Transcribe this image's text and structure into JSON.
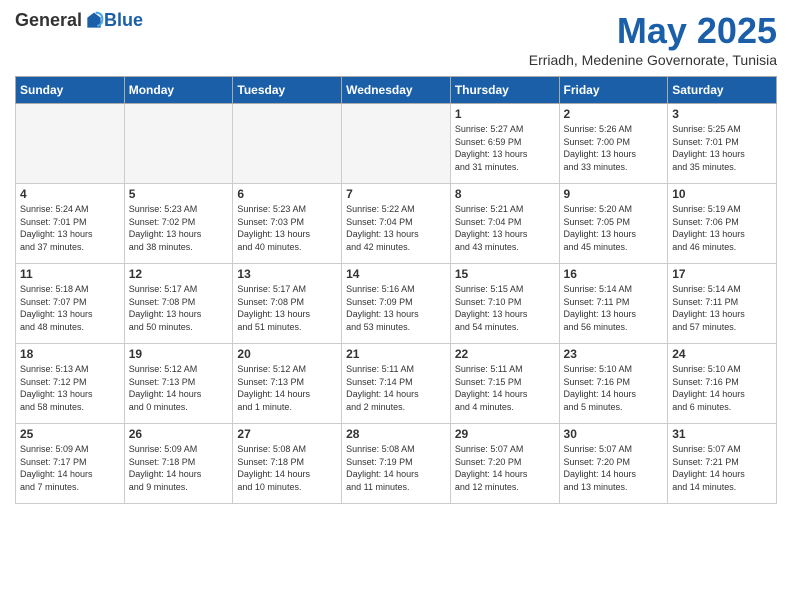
{
  "logo": {
    "general": "General",
    "blue": "Blue"
  },
  "header": {
    "month": "May 2025",
    "location": "Erriadh, Medenine Governorate, Tunisia"
  },
  "weekdays": [
    "Sunday",
    "Monday",
    "Tuesday",
    "Wednesday",
    "Thursday",
    "Friday",
    "Saturday"
  ],
  "weeks": [
    [
      {
        "day": "",
        "info": ""
      },
      {
        "day": "",
        "info": ""
      },
      {
        "day": "",
        "info": ""
      },
      {
        "day": "",
        "info": ""
      },
      {
        "day": "1",
        "info": "Sunrise: 5:27 AM\nSunset: 6:59 PM\nDaylight: 13 hours\nand 31 minutes."
      },
      {
        "day": "2",
        "info": "Sunrise: 5:26 AM\nSunset: 7:00 PM\nDaylight: 13 hours\nand 33 minutes."
      },
      {
        "day": "3",
        "info": "Sunrise: 5:25 AM\nSunset: 7:01 PM\nDaylight: 13 hours\nand 35 minutes."
      }
    ],
    [
      {
        "day": "4",
        "info": "Sunrise: 5:24 AM\nSunset: 7:01 PM\nDaylight: 13 hours\nand 37 minutes."
      },
      {
        "day": "5",
        "info": "Sunrise: 5:23 AM\nSunset: 7:02 PM\nDaylight: 13 hours\nand 38 minutes."
      },
      {
        "day": "6",
        "info": "Sunrise: 5:23 AM\nSunset: 7:03 PM\nDaylight: 13 hours\nand 40 minutes."
      },
      {
        "day": "7",
        "info": "Sunrise: 5:22 AM\nSunset: 7:04 PM\nDaylight: 13 hours\nand 42 minutes."
      },
      {
        "day": "8",
        "info": "Sunrise: 5:21 AM\nSunset: 7:04 PM\nDaylight: 13 hours\nand 43 minutes."
      },
      {
        "day": "9",
        "info": "Sunrise: 5:20 AM\nSunset: 7:05 PM\nDaylight: 13 hours\nand 45 minutes."
      },
      {
        "day": "10",
        "info": "Sunrise: 5:19 AM\nSunset: 7:06 PM\nDaylight: 13 hours\nand 46 minutes."
      }
    ],
    [
      {
        "day": "11",
        "info": "Sunrise: 5:18 AM\nSunset: 7:07 PM\nDaylight: 13 hours\nand 48 minutes."
      },
      {
        "day": "12",
        "info": "Sunrise: 5:17 AM\nSunset: 7:08 PM\nDaylight: 13 hours\nand 50 minutes."
      },
      {
        "day": "13",
        "info": "Sunrise: 5:17 AM\nSunset: 7:08 PM\nDaylight: 13 hours\nand 51 minutes."
      },
      {
        "day": "14",
        "info": "Sunrise: 5:16 AM\nSunset: 7:09 PM\nDaylight: 13 hours\nand 53 minutes."
      },
      {
        "day": "15",
        "info": "Sunrise: 5:15 AM\nSunset: 7:10 PM\nDaylight: 13 hours\nand 54 minutes."
      },
      {
        "day": "16",
        "info": "Sunrise: 5:14 AM\nSunset: 7:11 PM\nDaylight: 13 hours\nand 56 minutes."
      },
      {
        "day": "17",
        "info": "Sunrise: 5:14 AM\nSunset: 7:11 PM\nDaylight: 13 hours\nand 57 minutes."
      }
    ],
    [
      {
        "day": "18",
        "info": "Sunrise: 5:13 AM\nSunset: 7:12 PM\nDaylight: 13 hours\nand 58 minutes."
      },
      {
        "day": "19",
        "info": "Sunrise: 5:12 AM\nSunset: 7:13 PM\nDaylight: 14 hours\nand 0 minutes."
      },
      {
        "day": "20",
        "info": "Sunrise: 5:12 AM\nSunset: 7:13 PM\nDaylight: 14 hours\nand 1 minute."
      },
      {
        "day": "21",
        "info": "Sunrise: 5:11 AM\nSunset: 7:14 PM\nDaylight: 14 hours\nand 2 minutes."
      },
      {
        "day": "22",
        "info": "Sunrise: 5:11 AM\nSunset: 7:15 PM\nDaylight: 14 hours\nand 4 minutes."
      },
      {
        "day": "23",
        "info": "Sunrise: 5:10 AM\nSunset: 7:16 PM\nDaylight: 14 hours\nand 5 minutes."
      },
      {
        "day": "24",
        "info": "Sunrise: 5:10 AM\nSunset: 7:16 PM\nDaylight: 14 hours\nand 6 minutes."
      }
    ],
    [
      {
        "day": "25",
        "info": "Sunrise: 5:09 AM\nSunset: 7:17 PM\nDaylight: 14 hours\nand 7 minutes."
      },
      {
        "day": "26",
        "info": "Sunrise: 5:09 AM\nSunset: 7:18 PM\nDaylight: 14 hours\nand 9 minutes."
      },
      {
        "day": "27",
        "info": "Sunrise: 5:08 AM\nSunset: 7:18 PM\nDaylight: 14 hours\nand 10 minutes."
      },
      {
        "day": "28",
        "info": "Sunrise: 5:08 AM\nSunset: 7:19 PM\nDaylight: 14 hours\nand 11 minutes."
      },
      {
        "day": "29",
        "info": "Sunrise: 5:07 AM\nSunset: 7:20 PM\nDaylight: 14 hours\nand 12 minutes."
      },
      {
        "day": "30",
        "info": "Sunrise: 5:07 AM\nSunset: 7:20 PM\nDaylight: 14 hours\nand 13 minutes."
      },
      {
        "day": "31",
        "info": "Sunrise: 5:07 AM\nSunset: 7:21 PM\nDaylight: 14 hours\nand 14 minutes."
      }
    ]
  ]
}
